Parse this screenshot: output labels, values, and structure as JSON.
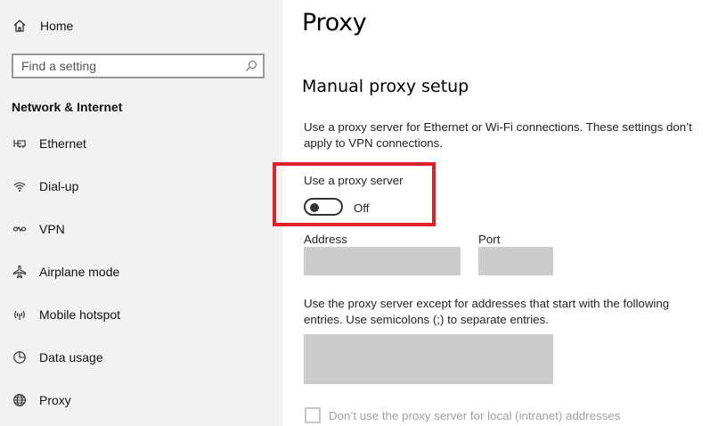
{
  "sidebar": {
    "home_label": "Home",
    "search_placeholder": "Find a setting",
    "section_title": "Network & Internet",
    "items": [
      {
        "label": "Ethernet",
        "icon": "ethernet-icon"
      },
      {
        "label": "Dial-up",
        "icon": "dial-up-icon"
      },
      {
        "label": "VPN",
        "icon": "vpn-icon"
      },
      {
        "label": "Airplane mode",
        "icon": "airplane-icon"
      },
      {
        "label": "Mobile hotspot",
        "icon": "hotspot-icon"
      },
      {
        "label": "Data usage",
        "icon": "data-usage-icon"
      },
      {
        "label": "Proxy",
        "icon": "globe-icon"
      }
    ]
  },
  "main": {
    "title": "Proxy",
    "section_title": "Manual proxy setup",
    "description": "Use a proxy server for Ethernet or Wi-Fi connections. These settings don’t apply to VPN connections.",
    "use_proxy_label": "Use a proxy server",
    "toggle_state": "Off",
    "address_label": "Address",
    "port_label": "Port",
    "address_value": "",
    "port_value": "",
    "exceptions_description": "Use the proxy server except for addresses that start with the following entries. Use semicolons (;) to separate entries.",
    "exceptions_value": "",
    "local_checkbox_label": "Don’t use the proxy server for local (intranet) addresses"
  },
  "colors": {
    "sidebar_bg": "#f2f2f2",
    "highlight": "#e0202a",
    "disabled_field": "#cccccc"
  }
}
